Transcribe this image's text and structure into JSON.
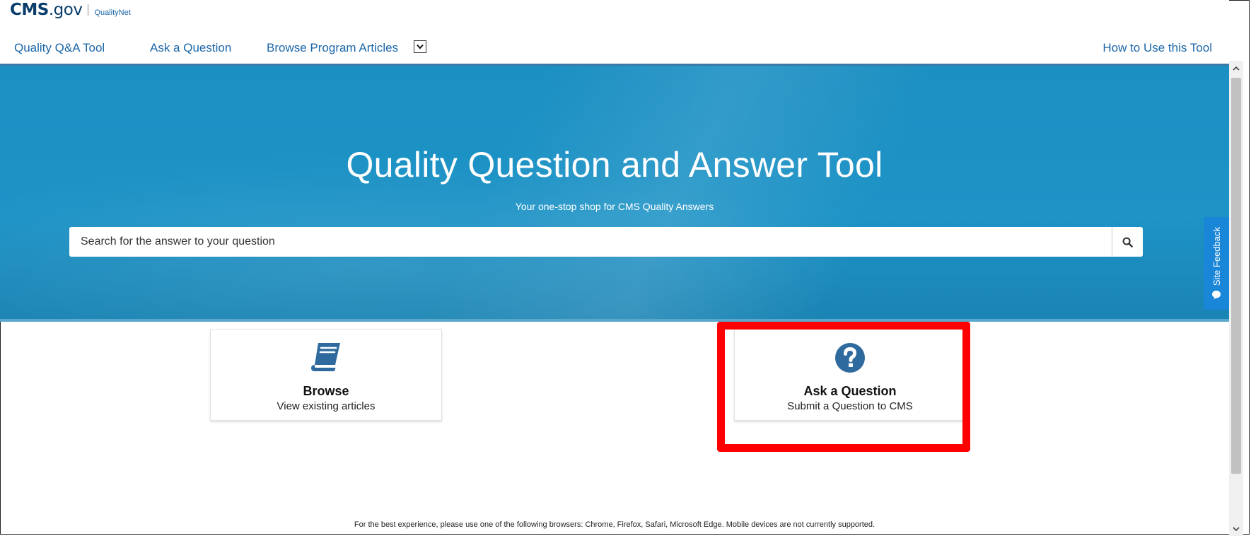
{
  "logo": {
    "brand_main": "CMS",
    "brand_suffix": ".gov",
    "subbrand": "QualityNet"
  },
  "nav": {
    "items": [
      {
        "label": "Quality Q&A Tool"
      },
      {
        "label": "Ask a Question"
      },
      {
        "label": "Browse Program Articles"
      }
    ],
    "right_link": "How to Use this Tool"
  },
  "hero": {
    "title": "Quality Question and Answer Tool",
    "subtitle": "Your one-stop shop for CMS Quality Answers",
    "search_placeholder": "Search for the answer to your question"
  },
  "feedback": {
    "label": "Site Feedback"
  },
  "cards": [
    {
      "title": "Browse",
      "description": "View existing articles",
      "icon": "book-icon"
    },
    {
      "title": "Ask a Question",
      "description": "Submit a Question to CMS",
      "icon": "question-circle-icon"
    }
  ],
  "footer": {
    "note": "For the best experience, please use one of the following browsers: Chrome, Firefox, Safari, Microsoft Edge. Mobile devices are not currently supported."
  },
  "colors": {
    "accent": "#1a66a8",
    "hero": "#1d93c6",
    "feedback": "#1a86d8",
    "icon": "#2f6a9f",
    "highlight": "#ff0000"
  }
}
